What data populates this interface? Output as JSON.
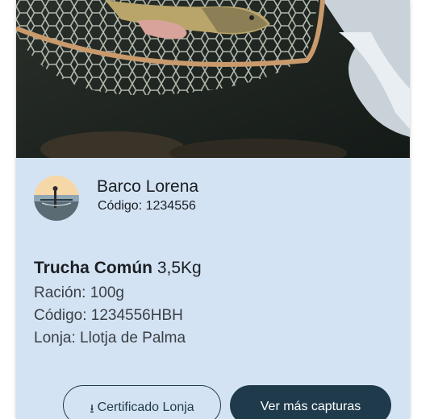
{
  "boat": {
    "name": "Barco Lorena",
    "code": "Código: 1234556"
  },
  "catch": {
    "species": "Trucha Común",
    "weight": "3,5Kg",
    "ration": "Ración: 100g",
    "code": "Código: 1234556HBH",
    "market": "Lonja: Llotja de Palma"
  },
  "actions": {
    "certificate_label": "Certificado Lonja",
    "more_catches_label": "Ver más capturas"
  },
  "colors": {
    "card_background": "#d4e3f3",
    "primary": "#1f3b4b"
  }
}
